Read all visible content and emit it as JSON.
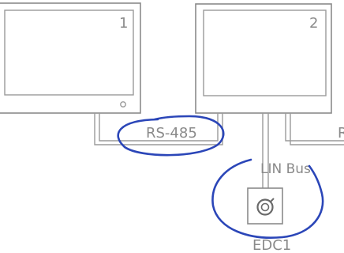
{
  "devices": [
    {
      "label": "1"
    },
    {
      "label": "2"
    }
  ],
  "buses": {
    "rs485": "RS-485",
    "lin": "LIN Bus",
    "edge_fragment": "R"
  },
  "controller": {
    "label": "EDC1",
    "icon": "rotary-knob-icon"
  },
  "annotation_color": "#2b46b8"
}
